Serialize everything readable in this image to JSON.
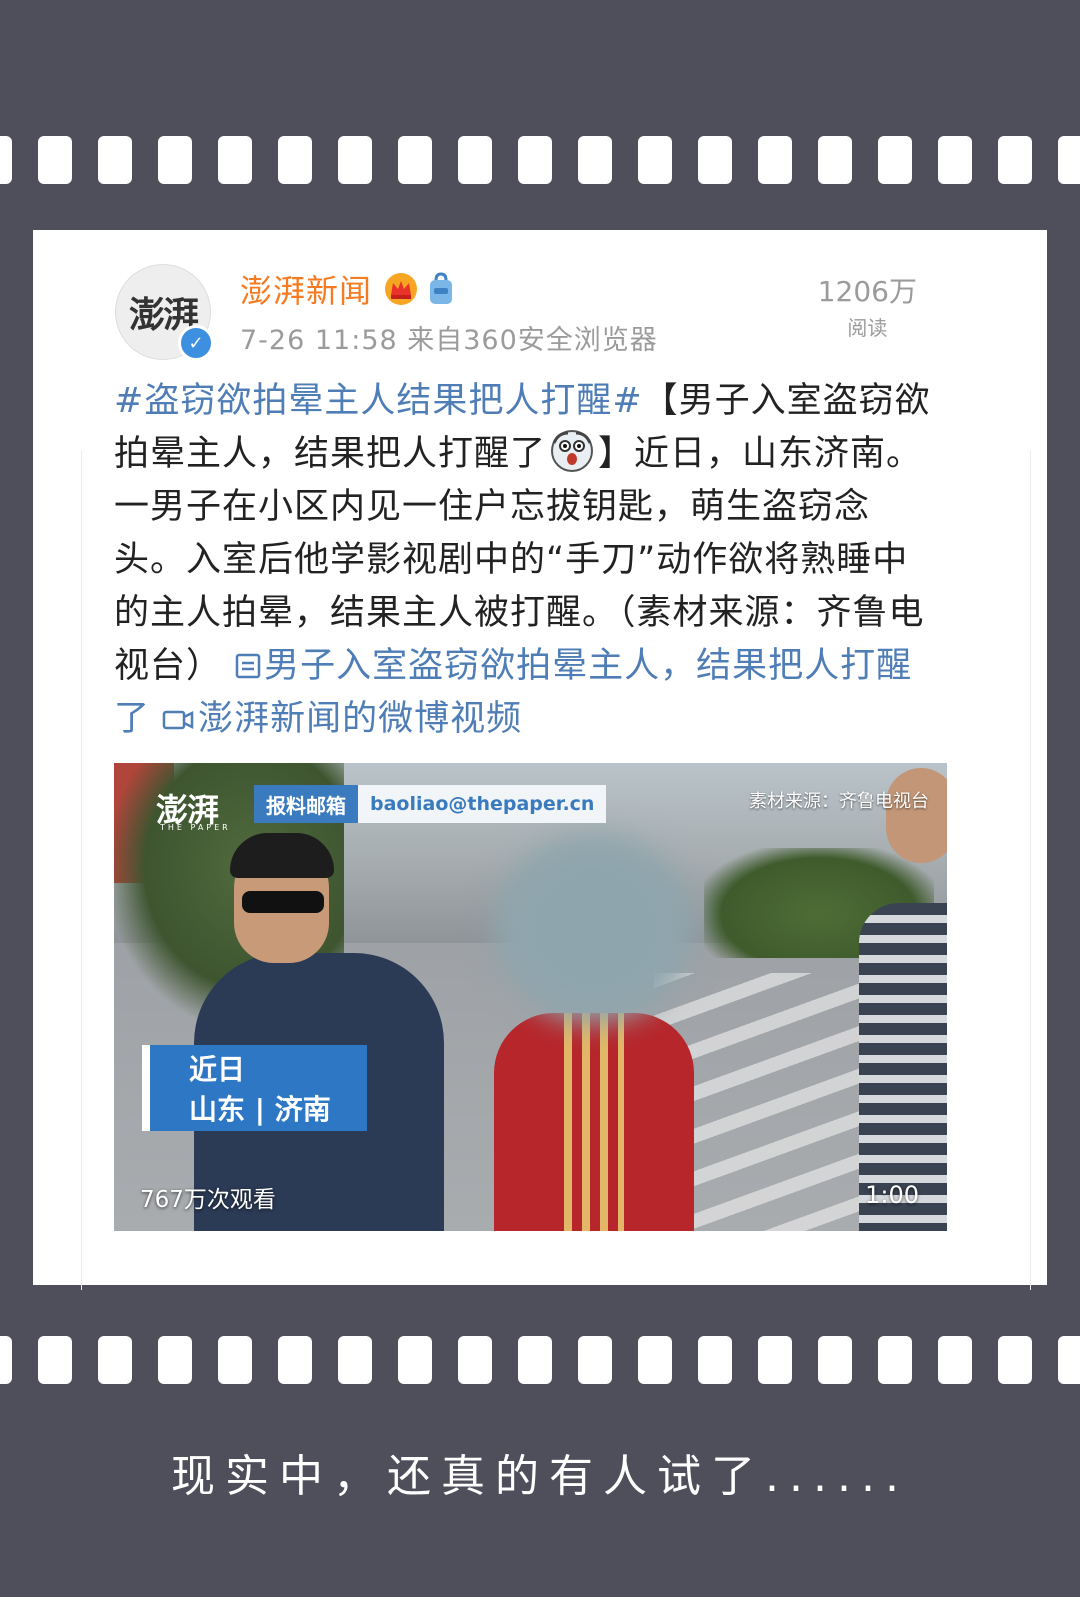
{
  "post": {
    "username": "澎湃新闻",
    "avatar_text": "澎湃",
    "verified_mark": "✓",
    "timestamp_source": "7-26 11:58  来自360安全浏览器",
    "reads_count": "1206万",
    "reads_label": "阅读",
    "hashtag": "#盗窃欲拍晕主人结果把人打醒#",
    "title_part1": "【男子入室盗窃欲拍晕主人，结果把人打醒了",
    "title_part2": "】近日，山东济南。一男子在小区内见一住户忘拔钥匙，萌生盗窃念头。入室后他学影视剧中的“手刀”动作欲将熟睡中的主人拍晕，结果主人被打醒。（素材来源：齐鲁电视台）",
    "article_link": "男子入室盗窃欲拍晕主人，结果把人打醒了",
    "video_link": "澎湃新闻的微博视频",
    "icons": {
      "crown": "crown-icon",
      "bag": "bag-icon",
      "emoji": "surprised-emoji-icon",
      "article": "article-link-icon",
      "video": "video-camera-icon"
    }
  },
  "video": {
    "logo": "澎湃",
    "logo_sub": "THE PAPER",
    "tip_label": "报料邮箱",
    "tip_email": "baoliao@thepaper.cn",
    "source": "素材来源：齐鲁电视台",
    "location_line1": "近日",
    "location_line2": "山东 | 济南",
    "views": "767万次观看",
    "duration": "1:00"
  },
  "caption": "现实中，还真的有人试了......",
  "colors": {
    "background": "#4f4e5b",
    "username": "#f47b22",
    "link": "#4f7db6",
    "verified": "#3d8fe0",
    "tip_blue": "#3a7abf"
  }
}
